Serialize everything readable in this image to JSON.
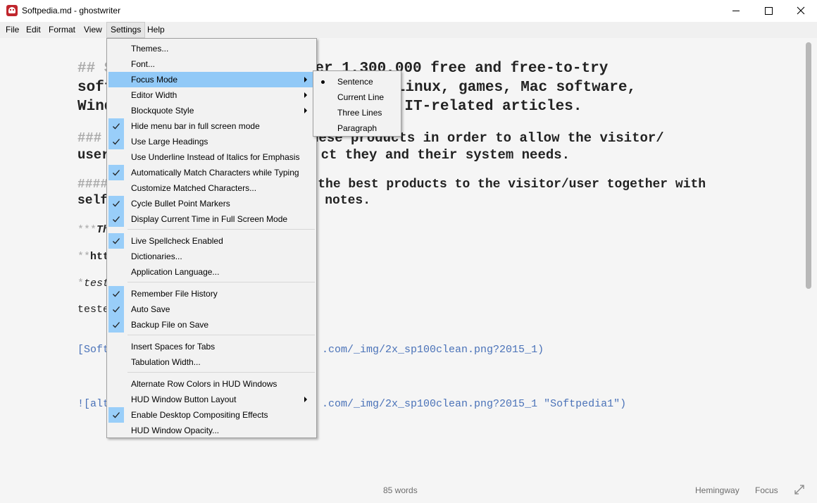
{
  "window": {
    "title": "Softpedia.md - ghostwriter"
  },
  "menubar": {
    "items": [
      "File",
      "Edit",
      "Format",
      "View",
      "Settings",
      "Help"
    ]
  },
  "settings_menu": {
    "items": [
      {
        "label": "Themes...",
        "checked": false,
        "submenu": false
      },
      {
        "label": "Font...",
        "checked": false,
        "submenu": false
      },
      {
        "label": "Focus Mode",
        "checked": false,
        "submenu": true,
        "highlighted": true
      },
      {
        "label": "Editor Width",
        "checked": false,
        "submenu": true
      },
      {
        "label": "Blockquote Style",
        "checked": false,
        "submenu": true
      },
      {
        "label": "Hide menu bar in full screen mode",
        "checked": true,
        "submenu": false
      },
      {
        "label": "Use Large Headings",
        "checked": true,
        "submenu": false
      },
      {
        "label": "Use Underline Instead of Italics for Emphasis",
        "checked": false,
        "submenu": false
      },
      {
        "label": "Automatically Match Characters while Typing",
        "checked": true,
        "submenu": false
      },
      {
        "label": "Customize Matched Characters...",
        "checked": false,
        "submenu": false
      },
      {
        "label": "Cycle Bullet Point Markers",
        "checked": true,
        "submenu": false
      },
      {
        "label": "Display Current Time in Full Screen Mode",
        "checked": true,
        "submenu": false
      },
      {
        "label": "Live Spellcheck Enabled",
        "checked": true,
        "submenu": false
      },
      {
        "label": "Dictionaries...",
        "checked": false,
        "submenu": false
      },
      {
        "label": "Application Language...",
        "checked": false,
        "submenu": false
      },
      {
        "label": "Remember File History",
        "checked": true,
        "submenu": false
      },
      {
        "label": "Auto Save",
        "checked": true,
        "submenu": false
      },
      {
        "label": "Backup File on Save",
        "checked": true,
        "submenu": false
      },
      {
        "label": "Insert Spaces for Tabs",
        "checked": false,
        "submenu": false
      },
      {
        "label": "Tabulation Width...",
        "checked": false,
        "submenu": false
      },
      {
        "label": "Alternate Row Colors in HUD Windows",
        "checked": false,
        "submenu": false
      },
      {
        "label": "HUD Window Button Layout",
        "checked": false,
        "submenu": true
      },
      {
        "label": "Enable Desktop Compositing Effects",
        "checked": true,
        "submenu": false
      },
      {
        "label": "HUD Window Opacity...",
        "checked": false,
        "submenu": false
      }
    ]
  },
  "focus_submenu": {
    "items": [
      {
        "label": "Sentence",
        "selected": true
      },
      {
        "label": "Current Line",
        "selected": false
      },
      {
        "label": "Three Lines",
        "selected": false
      },
      {
        "label": "Paragraph",
        "selected": false
      }
    ]
  },
  "editor": {
    "l1_mark": "## S",
    "l1_rest": "of over 1,300,000 free and free-to-try",
    "l2_a": "soft",
    "l2_b": "nix/Linux, games, Mac software,",
    "l3_a": "Wind",
    "l3_b": "IT-related articles.",
    "l4_mark": "### ",
    "l4_rest": "these products in order to allow the visitor/",
    "l5_a": "user",
    "l5_b": "ct they and their system needs.",
    "l6_mark": "####",
    "l6_rest": "the best products to the visitor/user together with",
    "l7_a": "self",
    "l7_b": "notes.",
    "l8_mark": "***",
    "l8_text": "Th",
    "l9_mark": "**",
    "l9_text": "htt",
    "l10_mark": "*",
    "l10_text": "test",
    "l11_text": "teste",
    "l12_a": "[Soft",
    "l12_b": ".com/_img/2x_sp100clean.png?2015_1)",
    "l13_a": "![alt",
    "l13_b": ".com/_img/2x_sp100clean.png?2015_1 \"Softpedia1\")"
  },
  "status": {
    "word_count": "85 words",
    "theme": "Hemingway",
    "focus": "Focus"
  },
  "colors": {
    "menu_highlight": "#91c9f7",
    "check_bg": "#99cef9",
    "link": "#4a72b8"
  }
}
